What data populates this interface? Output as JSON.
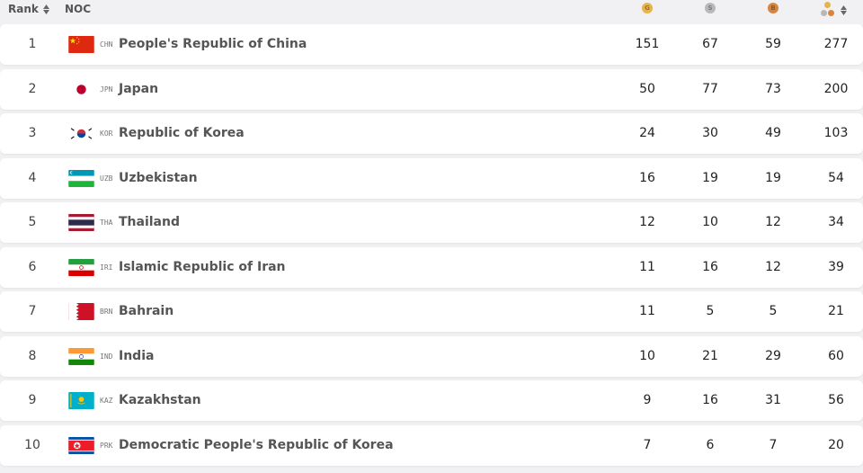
{
  "header": {
    "rank_label": "Rank",
    "noc_label": "NOC",
    "gold_letter": "G",
    "silver_letter": "S",
    "bronze_letter": "B"
  },
  "colors": {
    "gold": "#e8b347",
    "silver": "#b8b8b8",
    "bronze": "#d9843e",
    "row_bg": "#ffffff",
    "page_bg": "#f1f1f3"
  },
  "rows": [
    {
      "rank": "1",
      "code": "CHN",
      "name": "People's Republic of China",
      "gold": "151",
      "silver": "67",
      "bronze": "59",
      "total": "277",
      "flag": "chn"
    },
    {
      "rank": "2",
      "code": "JPN",
      "name": "Japan",
      "gold": "50",
      "silver": "77",
      "bronze": "73",
      "total": "200",
      "flag": "jpn"
    },
    {
      "rank": "3",
      "code": "KOR",
      "name": "Republic of Korea",
      "gold": "24",
      "silver": "30",
      "bronze": "49",
      "total": "103",
      "flag": "kor"
    },
    {
      "rank": "4",
      "code": "UZB",
      "name": "Uzbekistan",
      "gold": "16",
      "silver": "19",
      "bronze": "19",
      "total": "54",
      "flag": "uzb"
    },
    {
      "rank": "5",
      "code": "THA",
      "name": "Thailand",
      "gold": "12",
      "silver": "10",
      "bronze": "12",
      "total": "34",
      "flag": "tha"
    },
    {
      "rank": "6",
      "code": "IRI",
      "name": "Islamic Republic of Iran",
      "gold": "11",
      "silver": "16",
      "bronze": "12",
      "total": "39",
      "flag": "iri"
    },
    {
      "rank": "7",
      "code": "BRN",
      "name": "Bahrain",
      "gold": "11",
      "silver": "5",
      "bronze": "5",
      "total": "21",
      "flag": "brn"
    },
    {
      "rank": "8",
      "code": "IND",
      "name": "India",
      "gold": "10",
      "silver": "21",
      "bronze": "29",
      "total": "60",
      "flag": "ind"
    },
    {
      "rank": "9",
      "code": "KAZ",
      "name": "Kazakhstan",
      "gold": "9",
      "silver": "16",
      "bronze": "31",
      "total": "56",
      "flag": "kaz"
    },
    {
      "rank": "10",
      "code": "PRK",
      "name": "Democratic People's Republic of Korea",
      "gold": "7",
      "silver": "6",
      "bronze": "7",
      "total": "20",
      "flag": "prk"
    }
  ]
}
